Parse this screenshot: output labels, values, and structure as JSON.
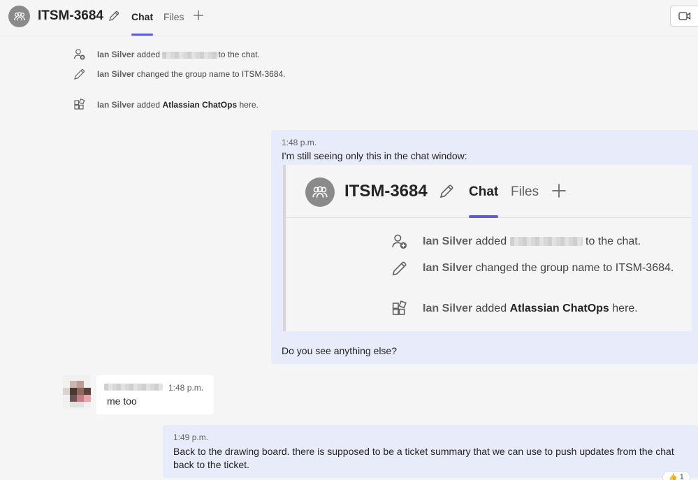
{
  "header": {
    "title": "ITSM-3684",
    "tabs": [
      {
        "label": "Chat",
        "active": true
      },
      {
        "label": "Files",
        "active": false
      }
    ]
  },
  "events": [
    {
      "icon": "add-person-icon",
      "actor": "Ian Silver",
      "verb": "added",
      "suffix": "to the chat."
    },
    {
      "icon": "pencil-icon",
      "actor": "Ian Silver",
      "text": "changed the group name to ITSM-3684."
    },
    {
      "icon": "apps-icon",
      "actor": "Ian Silver",
      "verb": "added",
      "target": "Atlassian ChatOps",
      "suffix": "here."
    }
  ],
  "messages": [
    {
      "time": "1:48 p.m.",
      "text": "I'm still seeing only this in the chat window:",
      "after_image": "Do you see anything else?"
    },
    {
      "time": "1:48 p.m.",
      "text": "me too"
    },
    {
      "time": "1:49 p.m.",
      "text": "Back to the drawing board. there is supposed to be a ticket summary that we can use to push updates from the chat back to the ticket.",
      "reaction_emoji": "👍",
      "reaction_count": "1"
    }
  ],
  "colors": {
    "accent": "#5b5fc7",
    "own_bubble": "#e8ebfa",
    "background": "#f5f5f5"
  }
}
